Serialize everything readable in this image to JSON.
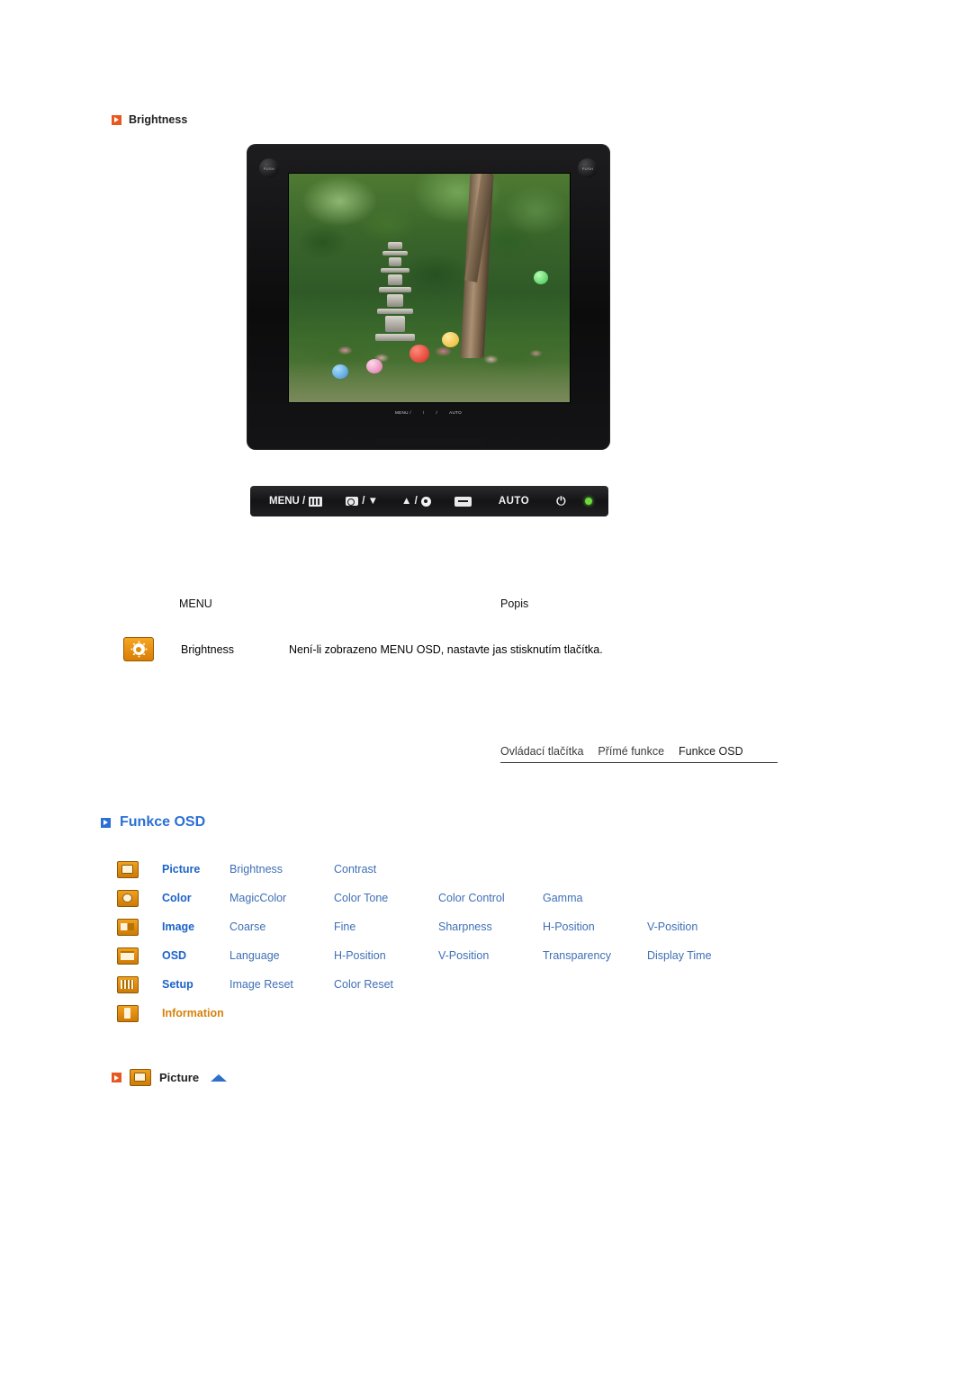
{
  "brightness_section": {
    "heading": "Brightness",
    "icon": "orange-play-square-icon",
    "monitor": {
      "push_left": "PUSH",
      "push_right": "PUSH",
      "bezel_labels": [
        "MENU /",
        "/",
        "/",
        "AUTO"
      ]
    },
    "control_bar": {
      "menu_label": "MENU /",
      "magic_label": "/ ▼",
      "brightness_label": "▲ /",
      "auto_label": "AUTO",
      "power_icon": "power-icon",
      "led": "#6cdc3b"
    },
    "table": {
      "col_menu": "MENU",
      "col_popis": "Popis",
      "row_icon": "brightness-gear-icon",
      "row_label": "Brightness",
      "row_desc": "Není-li zobrazeno MENU OSD, nastavte jas stisknutím tlačítka."
    }
  },
  "tabs": [
    {
      "label": "Ovládací tlačítka",
      "active": false
    },
    {
      "label": "Přímé funkce",
      "active": false
    },
    {
      "label": "Funkce OSD",
      "active": true
    }
  ],
  "osd_section": {
    "heading": "Funkce OSD",
    "icon": "blue-play-square-icon",
    "rows": [
      {
        "icon": "picture",
        "category": "Picture",
        "category_color": "blue",
        "items": [
          "Brightness",
          "Contrast"
        ]
      },
      {
        "icon": "color",
        "category": "Color",
        "category_color": "blue",
        "items": [
          "MagicColor",
          "Color Tone",
          "Color Control",
          "Gamma"
        ]
      },
      {
        "icon": "image",
        "category": "Image",
        "category_color": "blue",
        "items": [
          "Coarse",
          "Fine",
          "Sharpness",
          "H-Position",
          "V-Position"
        ]
      },
      {
        "icon": "osd",
        "category": "OSD",
        "category_color": "blue",
        "items": [
          "Language",
          "H-Position",
          "V-Position",
          "Transparency",
          "Display Time"
        ]
      },
      {
        "icon": "setup",
        "category": "Setup",
        "category_color": "blue",
        "items": [
          "Image Reset",
          "Color Reset"
        ]
      },
      {
        "icon": "info",
        "category": "Information",
        "category_color": "orange",
        "items": []
      }
    ]
  },
  "picture_subsection": {
    "label": "Picture",
    "square_icon": "orange-play-square-icon",
    "menu_icon": "picture-menu-icon",
    "up_arrow_icon": "blue-up-arrow-icon"
  },
  "colors": {
    "orange": "#e8571f",
    "blue": "#2b6fd4",
    "link_blue": "#3f6fb5",
    "cat_blue": "#1d63c8",
    "cat_orange": "#d5820c"
  }
}
